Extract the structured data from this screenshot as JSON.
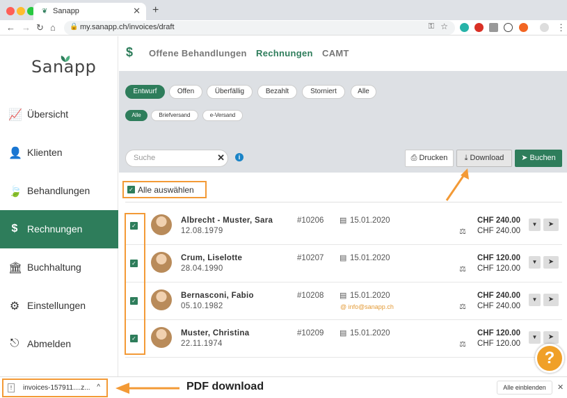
{
  "browser": {
    "tab_title": "Sanapp",
    "url": "my.sanapp.ch/invoices/draft",
    "new_tab": "+",
    "close": "✕"
  },
  "sidebar": {
    "logo": "Sanapp",
    "items": [
      {
        "label": "Übersicht",
        "icon": "chart-line-icon"
      },
      {
        "label": "Klienten",
        "icon": "user-icon"
      },
      {
        "label": "Behandlungen",
        "icon": "leaf-icon"
      },
      {
        "label": "Rechnungen",
        "icon": "dollar-icon",
        "active": true
      },
      {
        "label": "Buchhaltung",
        "icon": "bank-icon"
      },
      {
        "label": "Einstellungen",
        "icon": "gear-icon"
      },
      {
        "label": "Abmelden",
        "icon": "sign-out-icon"
      }
    ]
  },
  "topnav": {
    "icon": "$",
    "tabs": [
      "Offene Behandlungen",
      "Rechnungen",
      "CAMT"
    ],
    "active": "Rechnungen"
  },
  "filters": {
    "status": [
      "Entwurf",
      "Offen",
      "Überfällig",
      "Bezahlt",
      "Storniert",
      "Alle"
    ],
    "status_active": "Entwurf",
    "delivery": [
      "Alle",
      "Briefversand",
      "e-Versand"
    ],
    "delivery_active": "Alle"
  },
  "toolbar": {
    "search_placeholder": "Suche",
    "print_label": "Drucken",
    "download_label": "Download",
    "book_label": "Buchen",
    "select_all_label": "Alle auswählen"
  },
  "invoices": [
    {
      "name": "Albrecht - Muster, Sara",
      "dob": "12.08.1979",
      "number": "#10206",
      "date": "15.01.2020",
      "email": "",
      "amount": "CHF 240.00",
      "amount2": "CHF 240.00"
    },
    {
      "name": "Crum, Liselotte",
      "dob": "28.04.1990",
      "number": "#10207",
      "date": "15.01.2020",
      "email": "",
      "amount": "CHF 120.00",
      "amount2": "CHF 120.00"
    },
    {
      "name": "Bernasconi, Fabio",
      "dob": "05.10.1982",
      "number": "#10208",
      "date": "15.01.2020",
      "email": "info@sanapp.ch",
      "amount": "CHF 240.00",
      "amount2": "CHF 240.00"
    },
    {
      "name": "Muster, Christina",
      "dob": "22.11.1974",
      "number": "#10209",
      "date": "15.01.2020",
      "email": "",
      "amount": "CHF 120.00",
      "amount2": "CHF 120.00"
    }
  ],
  "help": "?",
  "downloads": {
    "file": "invoices-157911....z...",
    "annotation": "PDF download",
    "show_all": "Alle einblenden"
  },
  "colors": {
    "accent": "#2e7d5b",
    "highlight": "#f39a36",
    "help": "#f0a028"
  }
}
